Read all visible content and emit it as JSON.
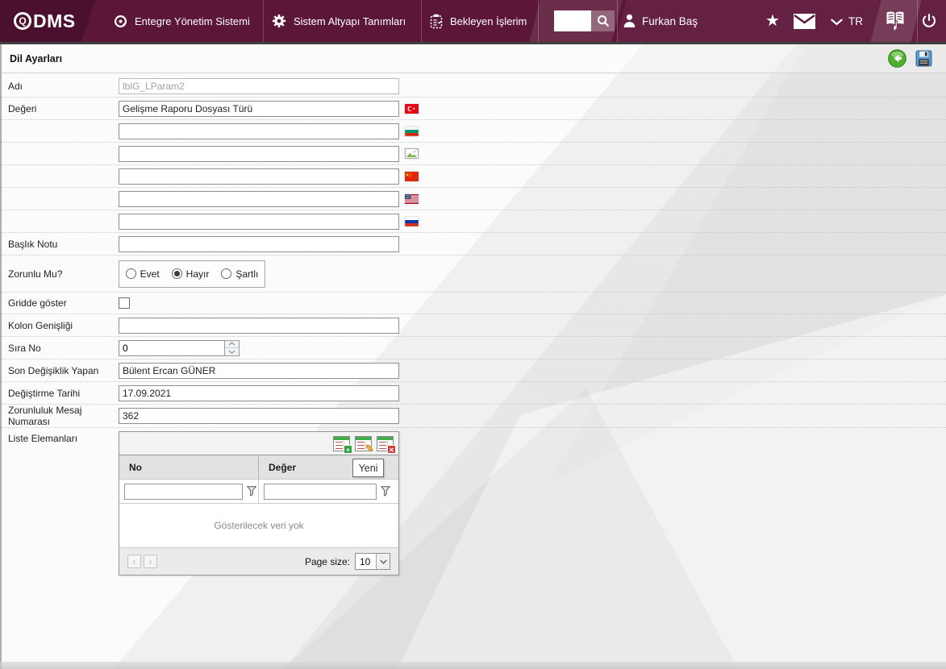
{
  "navbar": {
    "logo_q": "Q",
    "logo_text": "DMS",
    "menu": [
      {
        "label": "Entegre Yönetim Sistemi"
      },
      {
        "label": "Sistem Altyapı Tanımları"
      },
      {
        "label": "Bekleyen İşlerim"
      }
    ],
    "search_value": "",
    "user_name": "Furkan Baş",
    "language": "TR"
  },
  "icons": {
    "star": "★",
    "page_prev": "‹",
    "page_next": "›"
  },
  "titlebar": {
    "title": "Dil Ayarları"
  },
  "form": {
    "adi": {
      "label": "Adı",
      "value": "lblG_LParam2"
    },
    "degeri": {
      "label": "Değeri",
      "value": "Gelişme Raporu Dosyası Türü"
    },
    "translations": [
      {
        "value": ""
      },
      {
        "value": ""
      },
      {
        "value": ""
      },
      {
        "value": ""
      },
      {
        "value": ""
      }
    ],
    "baslik_notu": {
      "label": "Başlık Notu",
      "value": ""
    },
    "zorunlu": {
      "label": "Zorunlu Mu?",
      "options": [
        {
          "label": "Evet"
        },
        {
          "label": "Hayır"
        },
        {
          "label": "Şartlı"
        }
      ],
      "selected": "Hayır"
    },
    "gridde_goster": {
      "label": "Gridde göster",
      "checked": false
    },
    "kolon_genisligi": {
      "label": "Kolon Genişliği",
      "value": ""
    },
    "sira_no": {
      "label": "Sıra No",
      "value": "0"
    },
    "son_degisiklik_yapan": {
      "label": "Son Değişiklik Yapan",
      "value": "Bülent Ercan GÜNER"
    },
    "degistirme_tarihi": {
      "label": "Değiştirme Tarihi",
      "value": "17.09.2021"
    },
    "zorunluluk_mesaj_numarasi": {
      "label": "Zorunluluk Mesaj Numarası",
      "value": "362"
    },
    "liste_elemanlari": {
      "label": "Liste Elemanları"
    }
  },
  "grid": {
    "columns": [
      {
        "label": "No"
      },
      {
        "label": "Değer"
      }
    ],
    "filters": [
      {
        "value": ""
      },
      {
        "value": ""
      }
    ],
    "tooltip": "Yeni",
    "empty_text": "Gösterilecek veri yok",
    "pager": {
      "page_size_label": "Page size:",
      "page_size": "10"
    }
  },
  "colors": {
    "navbar": "#5c1637",
    "navbar_dark": "#4b102d",
    "accent_red": "#e30a17"
  }
}
